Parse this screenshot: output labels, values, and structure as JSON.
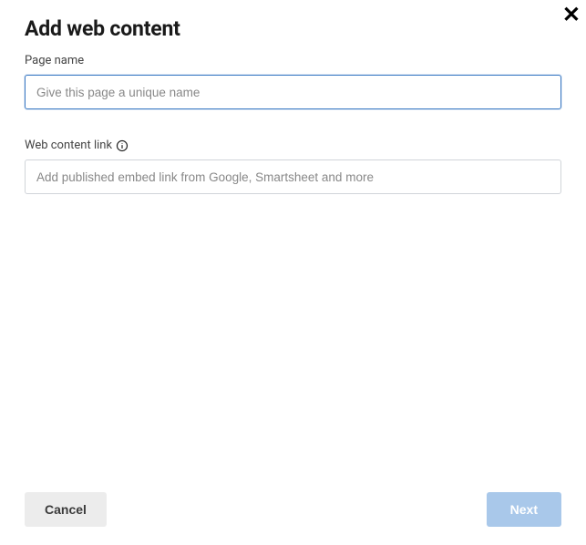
{
  "dialog": {
    "title": "Add web content",
    "close_label": "✕"
  },
  "fields": {
    "page_name": {
      "label": "Page name",
      "placeholder": "Give this page a unique name",
      "value": ""
    },
    "web_content_link": {
      "label": "Web content link",
      "placeholder": "Add published embed link from Google, Smartsheet and more",
      "value": ""
    }
  },
  "buttons": {
    "cancel": "Cancel",
    "next": "Next"
  }
}
